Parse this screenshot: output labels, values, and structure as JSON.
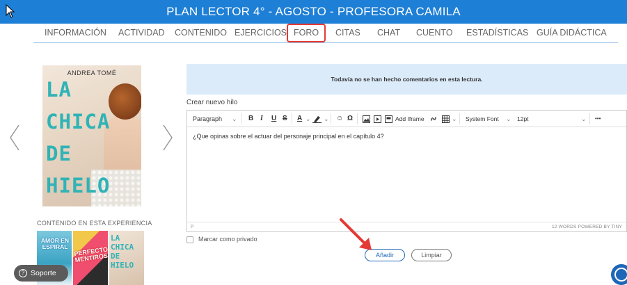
{
  "header": {
    "title": "PLAN LECTOR 4° - AGOSTO - PROFESORA CAMILA"
  },
  "nav": {
    "items": [
      "INFORMACIÓN",
      "ACTIVIDAD",
      "CONTENIDO",
      "EJERCICIOS",
      "FORO",
      "CITAS",
      "CHAT",
      "CUENTO",
      "ESTADÍSTICAS",
      "GUÍA DIDÁCTICA"
    ],
    "active": "FORO",
    "highlight_color": "#e53935"
  },
  "book": {
    "author": "ANDREA TOMÉ",
    "title_lines": [
      "LA",
      "CHICA",
      "DE",
      "HIELO"
    ]
  },
  "experience": {
    "label": "CONTENIDO EN ESTA EXPERIENCIA",
    "thumb1_text": "AMOR EN ESPIRAL",
    "thumb2_text": "PERFECTOS MENTIROSOS",
    "thumb3_lines": [
      "LA",
      "CHICA",
      "DE",
      "HIELO"
    ]
  },
  "support": {
    "label": "Soporte"
  },
  "forum": {
    "notice": "Todavía no se han hecho comentarios en esta lectura.",
    "new_thread_label": "Crear nuevo hilo"
  },
  "editor": {
    "toolbar": {
      "block_format": "Paragraph",
      "bold": "B",
      "italic": "I",
      "underline": "U",
      "strike": "S",
      "font_color": "A",
      "emoji": "☺",
      "special_char": "Ω",
      "add_iframe": "Add Iframe",
      "font_family": "System Font",
      "font_size": "12pt",
      "more": "•••"
    },
    "content": "¿Que opinas sobre el actuar del personaje principal en el capítulo 4?",
    "status_path": "P",
    "status_words": "12 WORDS  POWERED BY TINY"
  },
  "private": {
    "label": "Marcar como privado",
    "checked": false
  },
  "buttons": {
    "add": "Añadir",
    "clear": "Limpiar"
  },
  "colors": {
    "header": "#1e7fd6",
    "notice_bg": "#dcebfa",
    "button": "#1e66b8"
  }
}
